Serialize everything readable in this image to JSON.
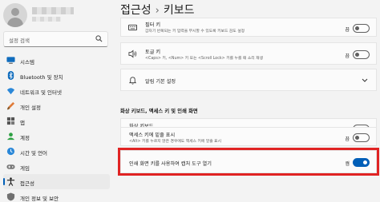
{
  "sidebar": {
    "search_placeholder": "설정 검색",
    "items": [
      {
        "label": "시스템",
        "icon": "monitor-icon"
      },
      {
        "label": "Bluetooth 및 장치",
        "icon": "bluetooth-icon"
      },
      {
        "label": "네트워크 및 인터넷",
        "icon": "wifi-icon"
      },
      {
        "label": "개인 설정",
        "icon": "brush-icon"
      },
      {
        "label": "앱",
        "icon": "apps-icon"
      },
      {
        "label": "계정",
        "icon": "account-icon"
      },
      {
        "label": "시간 및 언어",
        "icon": "globe-clock-icon"
      },
      {
        "label": "게임",
        "icon": "game-controller-icon"
      },
      {
        "label": "접근성",
        "icon": "accessibility-icon",
        "selected": true
      },
      {
        "label": "개인 정보 및 보안",
        "icon": "shield-icon"
      }
    ]
  },
  "header": {
    "parent": "접근성",
    "separator": "›",
    "current": "키보드"
  },
  "settings": [
    {
      "title": "필터 키",
      "desc": "갑자기 반복되는 키 입력을 무시할 수 있도록 키보드 감도 설정",
      "state": "끔",
      "on": false
    },
    {
      "title": "토글 키",
      "desc": "<Caps> 키, <Num> 키 또는 <Scroll Lock> 키를 누를 때 소리 재생",
      "state": "끔",
      "on": false
    },
    {
      "title": "알림 기본 설정"
    }
  ],
  "section": {
    "title": "화상 키보드, 액세스 키 및 인쇄 화면"
  },
  "section_settings": [
    {
      "title": "화상 키보드",
      "desc": "Windows 로고 키 ⊞ + Ctrl + O를 눌러 화상 키보드를 켜거나 끄기",
      "state": "끔",
      "on": false
    },
    {
      "title": "액세스 키에 밑줄 표시",
      "desc": "<Alt> 키를 누르지 않은 경우에도 액세스 키에 밑줄 표시",
      "state": "끔",
      "on": false
    },
    {
      "title": "인쇄 화면 키를 사용하여 캡처 도구 열기",
      "state": "켬",
      "on": true
    }
  ],
  "colors": {
    "accent": "#005fb8",
    "highlight_border": "#e02323",
    "background": "#f3f3f3",
    "card": "#fbfbfb"
  }
}
